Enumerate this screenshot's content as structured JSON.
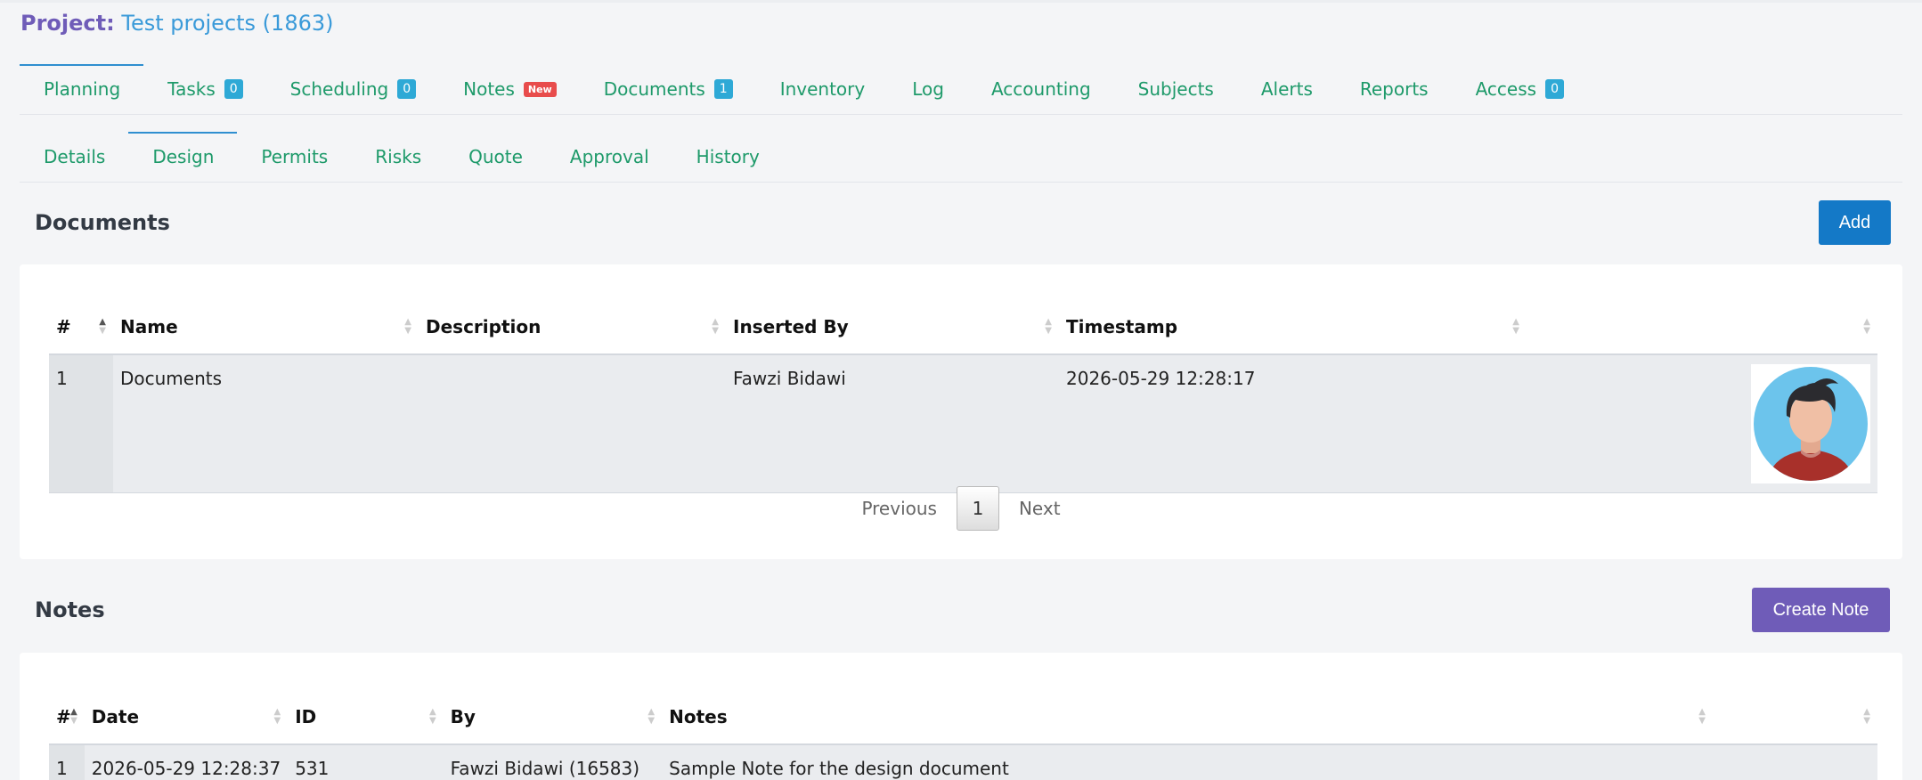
{
  "project": {
    "label": "Project:",
    "name": "Test projects (1863)"
  },
  "main_tabs": [
    {
      "label": "Planning",
      "badge": ""
    },
    {
      "label": "Tasks",
      "badge": "0"
    },
    {
      "label": "Scheduling",
      "badge": "0"
    },
    {
      "label": "Notes",
      "badge": "New"
    },
    {
      "label": "Documents",
      "badge": "1"
    },
    {
      "label": "Inventory",
      "badge": ""
    },
    {
      "label": "Log",
      "badge": ""
    },
    {
      "label": "Accounting",
      "badge": ""
    },
    {
      "label": "Subjects",
      "badge": ""
    },
    {
      "label": "Alerts",
      "badge": ""
    },
    {
      "label": "Reports",
      "badge": ""
    },
    {
      "label": "Access",
      "badge": "0"
    }
  ],
  "sub_tabs": [
    "Details",
    "Design",
    "Permits",
    "Risks",
    "Quote",
    "Approval",
    "History"
  ],
  "documents": {
    "title": "Documents",
    "add_label": "Add",
    "columns": [
      "#",
      "Name",
      "Description",
      "Inserted By",
      "Timestamp",
      ""
    ],
    "rows": [
      {
        "num": "1",
        "name": "Documents",
        "description": "",
        "inserted_by": "Fawzi Bidawi",
        "timestamp": "2026-05-29 12:28:17",
        "avatar": "user-avatar-icon"
      }
    ],
    "pager": {
      "previous": "Previous",
      "current": "1",
      "next": "Next"
    }
  },
  "notes": {
    "title": "Notes",
    "create_label": "Create Note",
    "columns": [
      "#",
      "Date",
      "ID",
      "By",
      "Notes",
      ""
    ],
    "rows": [
      {
        "num": "1",
        "date": "2026-05-29 12:28:37",
        "id": "531",
        "by": "Fawzi Bidawi (16583)",
        "notes": "Sample Note for the design document"
      }
    ]
  },
  "colors": {
    "accent_green": "#1e9a6a",
    "primary_blue": "#1479c7",
    "purple": "#6f5cb8",
    "badge_blue": "#2ea9d6",
    "badge_red": "#e84c4c"
  }
}
